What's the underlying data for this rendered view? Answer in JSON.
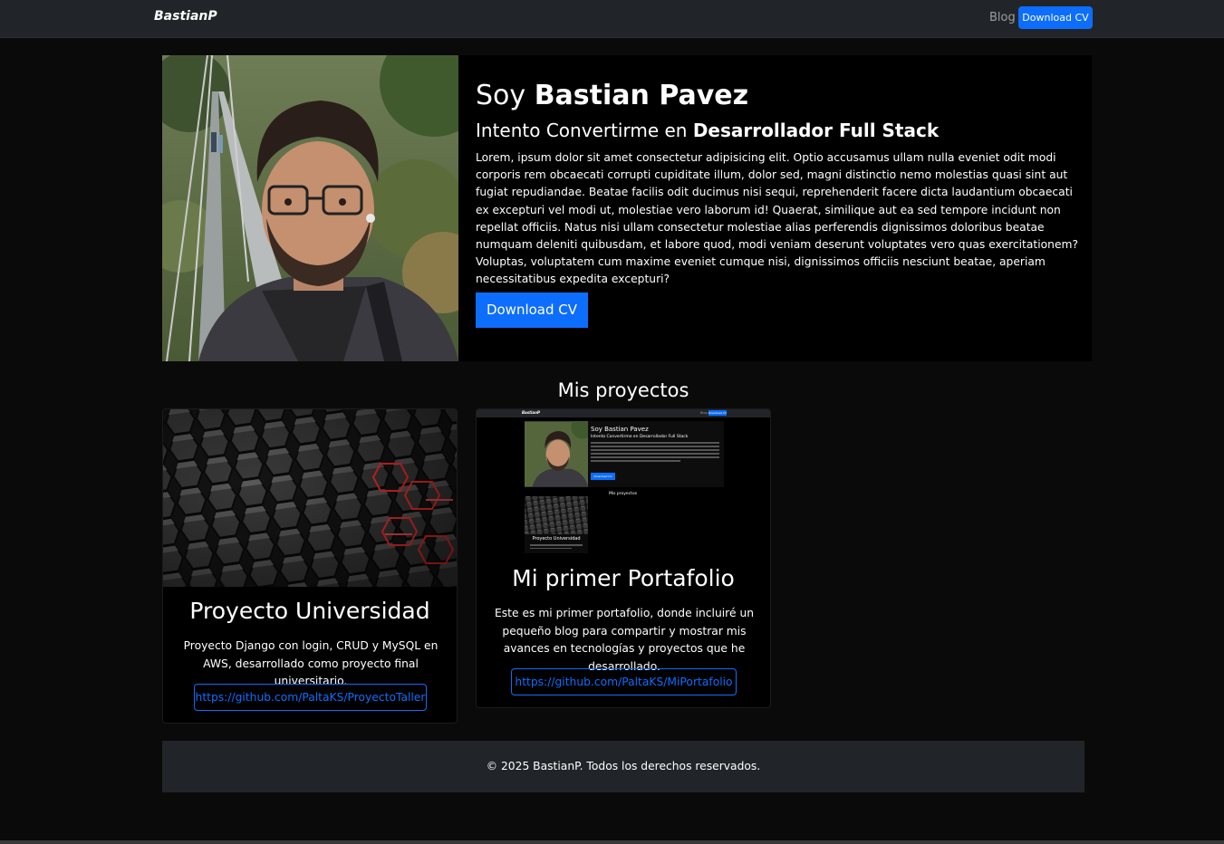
{
  "navbar": {
    "brand": "BastianP",
    "blog_label": "Blog",
    "download_label": "Download CV"
  },
  "hero": {
    "greeting": "Soy ",
    "name": "Bastian Pavez",
    "subtitle_prefix": "Intento Convertirme en ",
    "subtitle_bold": "Desarrollador Full Stack",
    "bio": "Lorem, ipsum dolor sit amet consectetur adipisicing elit. Optio accusamus ullam nulla eveniet odit modi corporis rem obcaecati corrupti cupiditate illum, dolor sed, magni distinctio nemo molestias quasi sint aut fugiat repudiandae. Beatae facilis odit ducimus nisi sequi, reprehenderit facere dicta laudantium obcaecati ex excepturi vel modi ut, molestiae vero laborum id! Quaerat, similique aut ea sed tempore incidunt non repellat officiis. Natus nisi ullam consectetur molestiae alias perferendis dignissimos doloribus beatae numquam deleniti quibusdam, et labore quod, modi veniam deserunt voluptates vero quas exercitationem? Voluptas, voluptatem cum maxime eveniet cumque nisi, dignissimos officiis nesciunt beatae, aperiam necessitatibus expedita excepturi?",
    "download_label": "Download CV"
  },
  "projects": {
    "title": "Mis proyectos",
    "items": [
      {
        "title": "Proyecto Universidad",
        "description": "Proyecto Django con login, CRUD y MySQL en AWS, desarrollado como proyecto final universitario.",
        "link": "https://github.com/PaltaKS/ProyectoTaller"
      },
      {
        "title": "Mi primer Portafolio",
        "description": "Este es mi primer portafolio, donde incluiré un pequeño blog para compartir y mostrar mis avances en tecnologías y proyectos que he desarrollado.",
        "link": "https://github.com/PaltaKS/MiPortafolio"
      }
    ]
  },
  "preview": {
    "brand": "BastianP",
    "blog_label": "Blog",
    "download_label": "Download CV",
    "greeting": "Soy Bastian Pavez",
    "subtitle": "Intento Convertirme en Desarrollador Full Stack",
    "download_btn": "Download CV",
    "section_title": "Mis proyectos",
    "card_title": "Proyecto Universidad"
  },
  "footer": {
    "text": "© 2025 BastianP. Todos los derechos reservados."
  },
  "colors": {
    "accent": "#0d6efd",
    "navbar_bg": "#212529",
    "page_bg": "#0a0a0a"
  }
}
